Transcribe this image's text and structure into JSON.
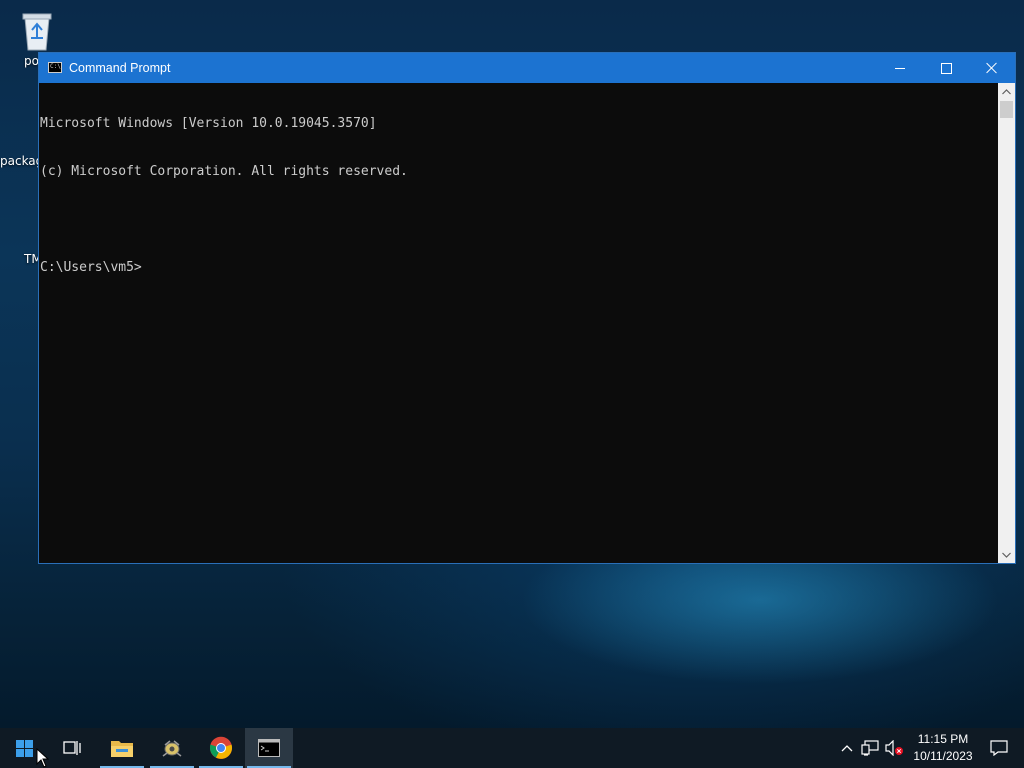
{
  "desktop": {
    "icons": [
      {
        "label": "po"
      },
      {
        "label": "packag"
      },
      {
        "label": "TM"
      }
    ]
  },
  "window": {
    "title": "Command Prompt",
    "console_lines": [
      "Microsoft Windows [Version 10.0.19045.3570]",
      "(c) Microsoft Corporation. All rights reserved.",
      "",
      "C:\\Users\\vm5>"
    ]
  },
  "taskbar": {
    "items": [
      {
        "name": "start",
        "icon": "windows-logo-icon"
      },
      {
        "name": "task-view",
        "icon": "task-view-icon"
      },
      {
        "name": "file-explorer",
        "icon": "folder-icon"
      },
      {
        "name": "app",
        "icon": "app-icon"
      },
      {
        "name": "chrome",
        "icon": "chrome-icon"
      },
      {
        "name": "command-prompt",
        "icon": "cmd-icon"
      }
    ],
    "tray": {
      "time": "11:15 PM",
      "date": "10/11/2023"
    }
  },
  "colors": {
    "titlebar": "#1c73d1",
    "console_bg": "#0c0c0c",
    "console_fg": "#cccccc",
    "taskbar": "#0f1a24",
    "accent_underline": "#76b9ed"
  }
}
